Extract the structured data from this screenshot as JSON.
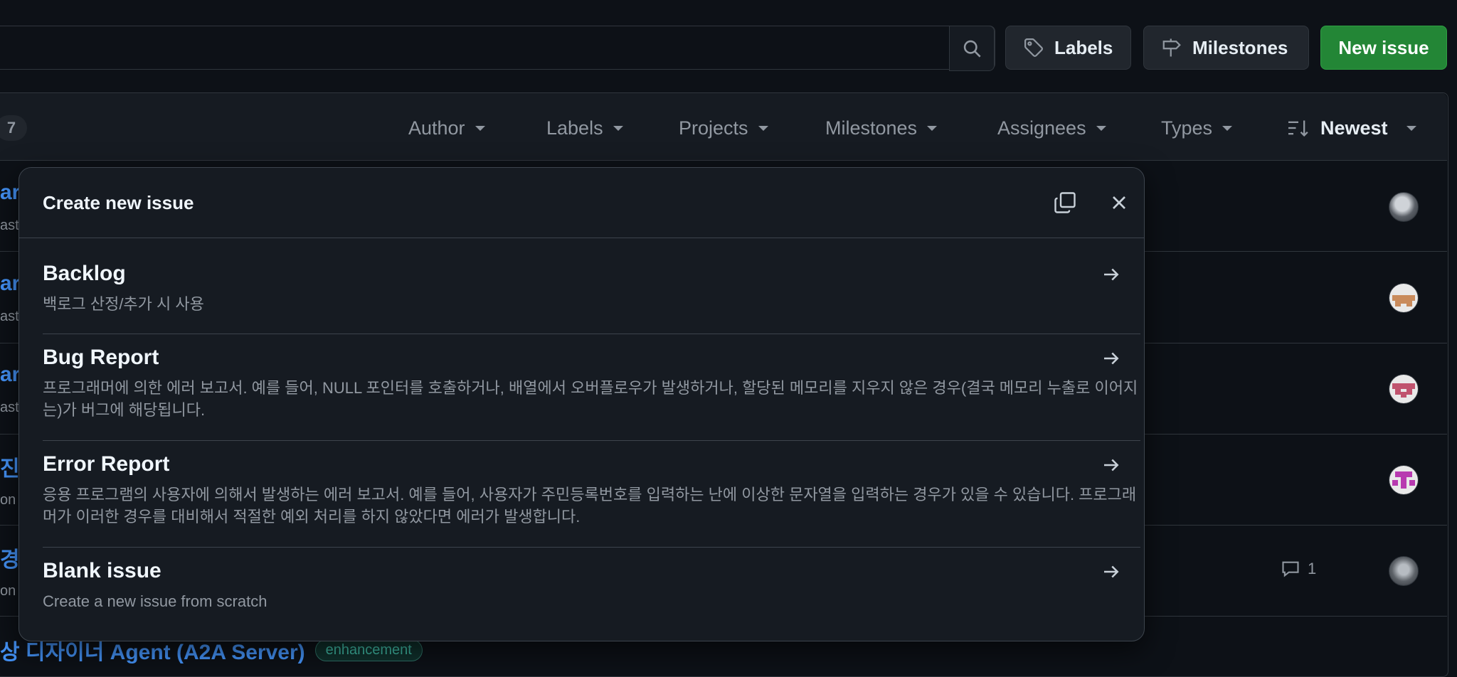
{
  "toolbar": {
    "labels_button": "Labels",
    "milestones_button": "Milestones",
    "new_issue_button": "New issue"
  },
  "list_header": {
    "open_count": "7",
    "filters": [
      "Author",
      "Labels",
      "Projects",
      "Milestones",
      "Assignees",
      "Types"
    ],
    "sort_label": "Newest"
  },
  "background_rows": {
    "title_fragments": [
      "ar",
      "ar",
      "ar",
      "진",
      "경"
    ],
    "meta_fragments": [
      "ast",
      "ast",
      "ast",
      "on",
      "on"
    ],
    "comment_count": "1",
    "last_row_title": "상 디자이너 Agent (A2A Server)",
    "last_row_label": "enhancement"
  },
  "modal": {
    "title": "Create new issue",
    "templates": [
      {
        "title": "Backlog",
        "description": "백로그 산정/추가 시 사용"
      },
      {
        "title": "Bug Report",
        "description": "프로그래머에 의한 에러 보고서. 예를 들어, NULL 포인터를 호출하거나, 배열에서 오버플로우가 발생하거나, 할당된 메모리를 지우지 않은 경우(결국 메모리 누출로 이어지는)가 버그에 해당됩니다."
      },
      {
        "title": "Error Report",
        "description": "응용 프로그램의 사용자에 의해서 발생하는 에러 보고서. 예를 들어, 사용자가 주민등록번호를 입력하는 난에 이상한 문자열을 입력하는 경우가 있을 수 있습니다. 프로그래머가 이러한 경우를 대비해서 적절한 예외 처리를 하지 않았다면 에러가 발생합니다."
      },
      {
        "title": "Blank issue",
        "description": "Create a new issue from scratch"
      }
    ]
  },
  "colors": {
    "background": "#0d1117",
    "surface": "#161b22",
    "border": "#30363d",
    "accent_link": "#4493f8",
    "primary_button": "#238636",
    "muted_text": "#9198a1"
  }
}
